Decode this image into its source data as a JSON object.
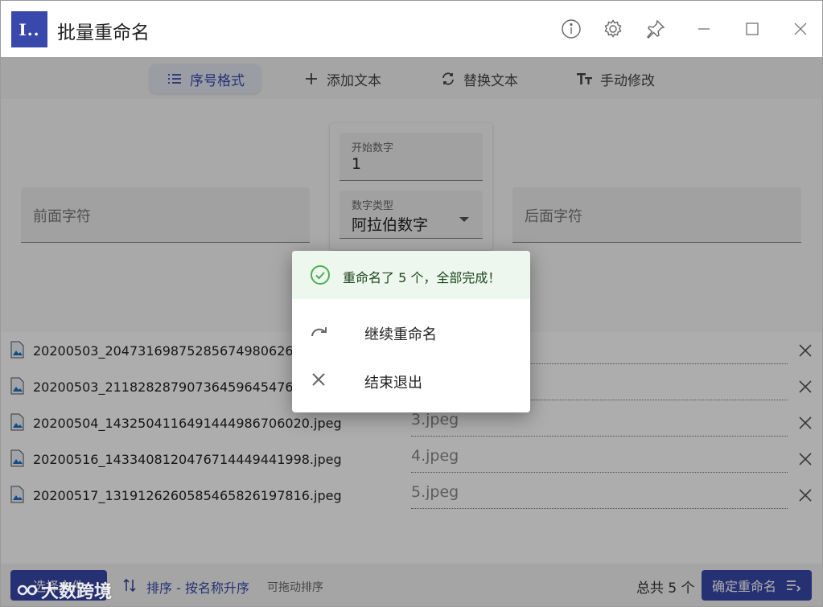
{
  "titlebar": {
    "logo_text": "I..",
    "title": "批量重命名",
    "icons": [
      "info-icon",
      "gear-icon",
      "pin-icon",
      "minimize-icon",
      "maximize-icon",
      "close-icon"
    ]
  },
  "tabs": [
    {
      "label": "序号格式",
      "icon": "list-icon",
      "active": true
    },
    {
      "label": "添加文本",
      "icon": "plus-icon",
      "active": false
    },
    {
      "label": "替换文本",
      "icon": "replace-icon",
      "active": false
    },
    {
      "label": "手动修改",
      "icon": "text-format-icon",
      "active": false
    }
  ],
  "form": {
    "prefix_placeholder": "前面字符",
    "start_number_label": "开始数字",
    "start_number_value": "1",
    "number_type_label": "数字类型",
    "number_type_value": "阿拉伯数字",
    "suffix_placeholder": "后面字符"
  },
  "files": [
    {
      "name": "20200503_2047316987528567498062678",
      "new_name": ""
    },
    {
      "name": "20200503_2118282879073645964547654",
      "new_name": ""
    },
    {
      "name": "20200504_143250411649144498670602O.jpeg",
      "new_name": "3.jpeg"
    },
    {
      "name": "20200516_143340812047671444944199 8.jpeg",
      "new_name": "4.jpeg"
    },
    {
      "name": "20200517_131912626058546582619781 6.jpeg",
      "new_name": "5.jpeg"
    }
  ],
  "bottombar": {
    "select_files_label": "选择文件",
    "sort_label": "排序 - 按名称升序",
    "drag_hint": "可拖动排序",
    "total_label": "总共 5 个",
    "confirm_label": "确定重命名"
  },
  "dialog": {
    "message": "重命名了 5 个，全部完成！",
    "continue_label": "继续重命名",
    "exit_label": "结束退出"
  },
  "watermark": "大数跨境",
  "colors": {
    "accent": "#3949ab",
    "success_bg": "#edf7ed",
    "success": "#4caf50"
  }
}
